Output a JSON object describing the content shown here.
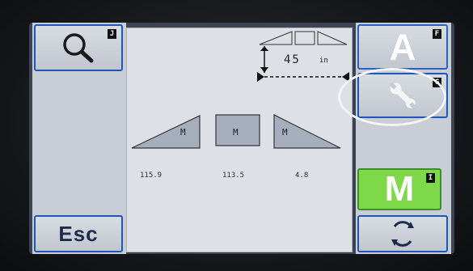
{
  "left_panel": {
    "search_key": "J",
    "esc_label": "Esc"
  },
  "right_panel": {
    "auto_key": "F",
    "auto_letter": "A",
    "settings_key": "G",
    "manual_key": "I",
    "manual_letter": "M",
    "manual_color": "#7ed84a"
  },
  "center": {
    "width_value": "45",
    "width_unit": "in",
    "sections": [
      {
        "mode": "M",
        "value": "115.9"
      },
      {
        "mode": "M",
        "value": "113.5"
      },
      {
        "mode": "M",
        "value": "4.8"
      }
    ]
  },
  "colors": {
    "button_border": "#1f57b8",
    "section_fill": "#a6aebd"
  }
}
